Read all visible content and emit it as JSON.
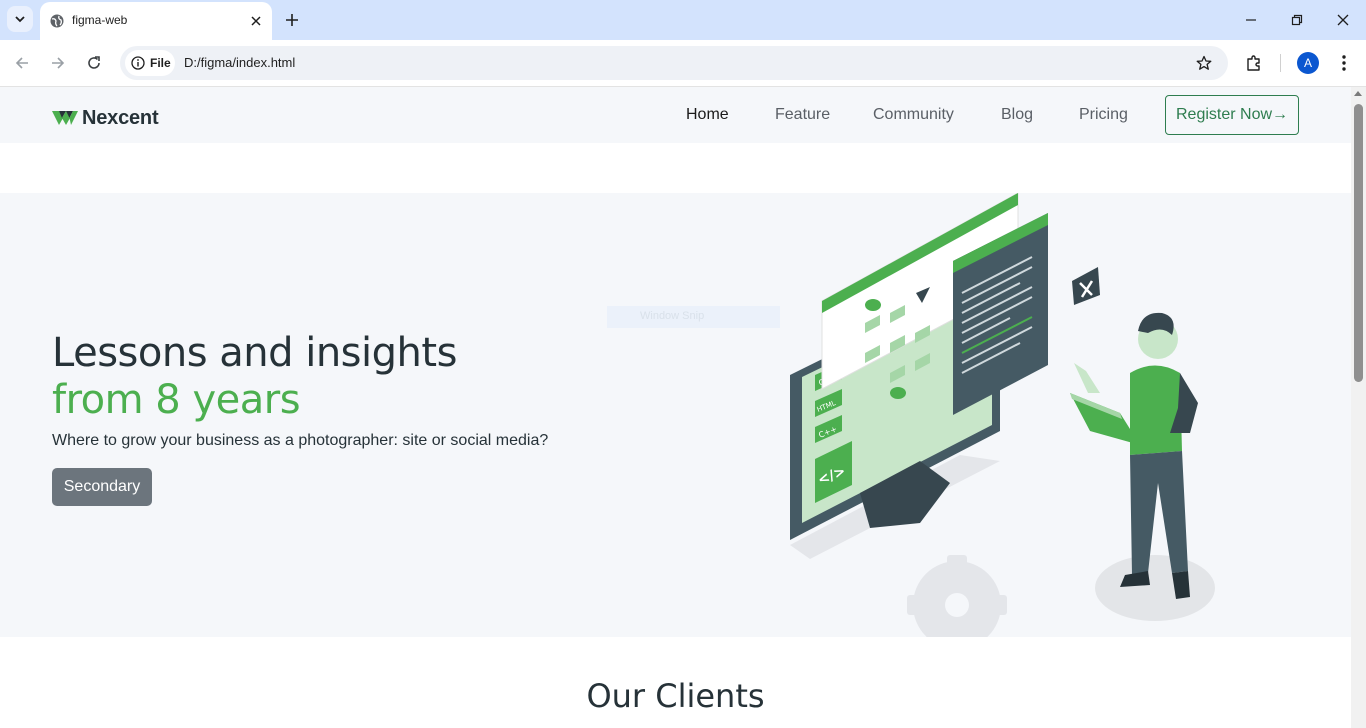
{
  "browser": {
    "tab_title": "figma-web",
    "site_chip_label": "File",
    "url": "D:/figma/index.html",
    "avatar_letter": "A"
  },
  "site": {
    "logo_text": "Nexcent",
    "nav": [
      {
        "label": "Home",
        "active": true
      },
      {
        "label": "Feature"
      },
      {
        "label": "Community"
      },
      {
        "label": "Blog"
      },
      {
        "label": "Pricing"
      }
    ],
    "register_label": "Register Now→"
  },
  "hero": {
    "title_line1": "Lessons and insights",
    "title_line2": "from 8 years",
    "subtitle": "Where to grow your business as a photographer: site or social media?",
    "button_label": "Secondary",
    "overlay_text": "Window Snip",
    "illustration_labels": [
      "CSS",
      "HTML",
      "C++",
      "</>"
    ]
  },
  "clients": {
    "title": "Our Clients"
  },
  "colors": {
    "accent_green": "#4caf4f",
    "dark_text": "#263238",
    "browser_frame": "#d3e3fd",
    "secondary_button": "#6c757d"
  }
}
